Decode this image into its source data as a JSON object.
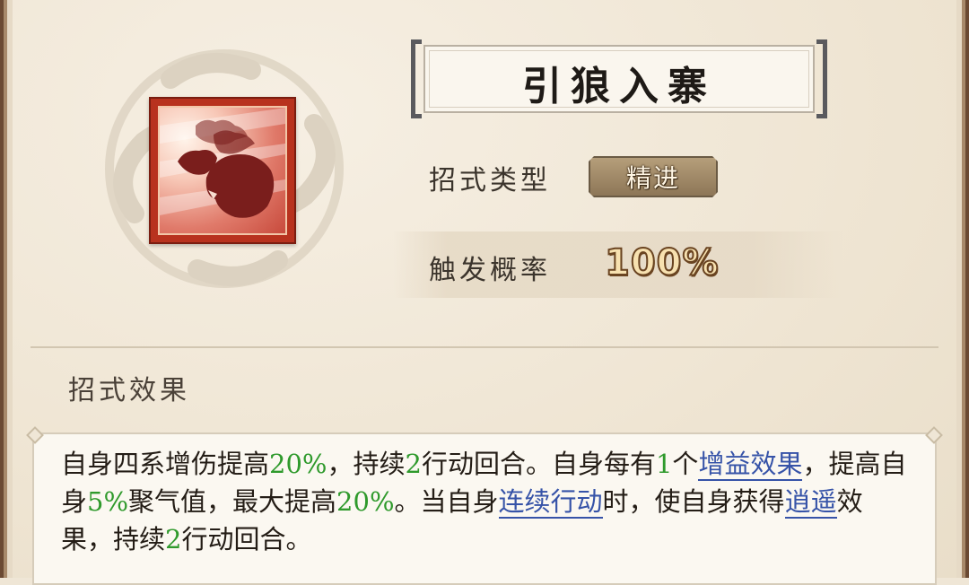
{
  "skill": {
    "name": "引狼入寨",
    "icon": "wolf-pack-icon",
    "type_label": "招式类型",
    "type_value": "精进",
    "prob_label": "触发概率",
    "prob_value": "100%"
  },
  "effect": {
    "title": "招式效果",
    "segments": [
      {
        "t": "自身四系增伤提高"
      },
      {
        "t": "20%",
        "c": "num"
      },
      {
        "t": "，持续"
      },
      {
        "t": "2",
        "c": "num"
      },
      {
        "t": "行动回合。自身每有"
      },
      {
        "t": "1",
        "c": "num"
      },
      {
        "t": "个"
      },
      {
        "t": "增益效果",
        "c": "link"
      },
      {
        "t": "，提高自身"
      },
      {
        "t": "5%",
        "c": "num"
      },
      {
        "t": "聚气值，最大提高"
      },
      {
        "t": "20%",
        "c": "num"
      },
      {
        "t": "。当自身"
      },
      {
        "t": "连续行动",
        "c": "link"
      },
      {
        "t": "时，使自身获得"
      },
      {
        "t": "逍遥",
        "c": "link"
      },
      {
        "t": "效果，持续"
      },
      {
        "t": "2",
        "c": "num"
      },
      {
        "t": "行动回合。"
      }
    ]
  },
  "colors": {
    "number": "#2f9a2c",
    "link": "#3653a8",
    "icon_frame": "#b8321e"
  }
}
